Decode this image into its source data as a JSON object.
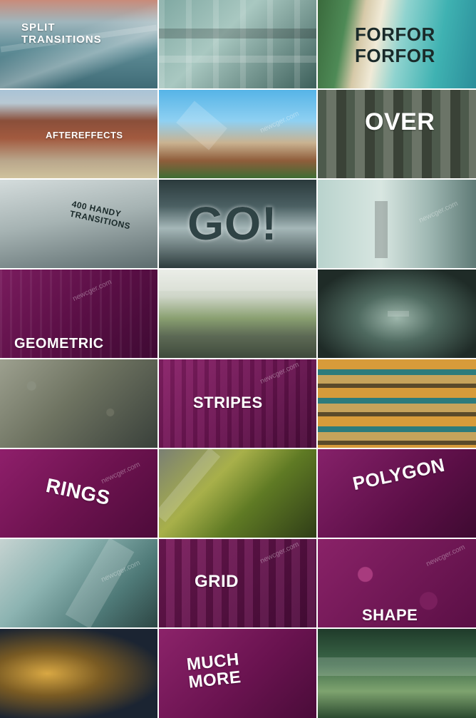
{
  "watermark": "newcger.com",
  "tiles": [
    {
      "id": "t00",
      "caption": "SPLIT TRANSITIONS"
    },
    {
      "id": "t01",
      "caption": ""
    },
    {
      "id": "t02",
      "caption": "FORFOR FORFOR"
    },
    {
      "id": "t10",
      "caption": "AFTEREFFECTS"
    },
    {
      "id": "t11",
      "caption": ""
    },
    {
      "id": "t12",
      "caption": "OVER"
    },
    {
      "id": "t20",
      "caption": "400 HANDY TRANSITIONS"
    },
    {
      "id": "t21",
      "caption": "GO!"
    },
    {
      "id": "t22",
      "caption": ""
    },
    {
      "id": "t30",
      "caption": "GEOMETRIC"
    },
    {
      "id": "t31",
      "caption": ""
    },
    {
      "id": "t32",
      "caption": ""
    },
    {
      "id": "t40",
      "caption": ""
    },
    {
      "id": "t41",
      "caption": "STRIPES"
    },
    {
      "id": "t42",
      "caption": ""
    },
    {
      "id": "t50",
      "caption": "RINGS"
    },
    {
      "id": "t51",
      "caption": ""
    },
    {
      "id": "t52",
      "caption": "POLYGON"
    },
    {
      "id": "t60",
      "caption": ""
    },
    {
      "id": "t61",
      "caption": "GRID"
    },
    {
      "id": "t62",
      "caption": "SHAPE"
    },
    {
      "id": "t70",
      "caption": ""
    },
    {
      "id": "t71",
      "caption": "MUCH MORE"
    },
    {
      "id": "t72",
      "caption": ""
    }
  ]
}
